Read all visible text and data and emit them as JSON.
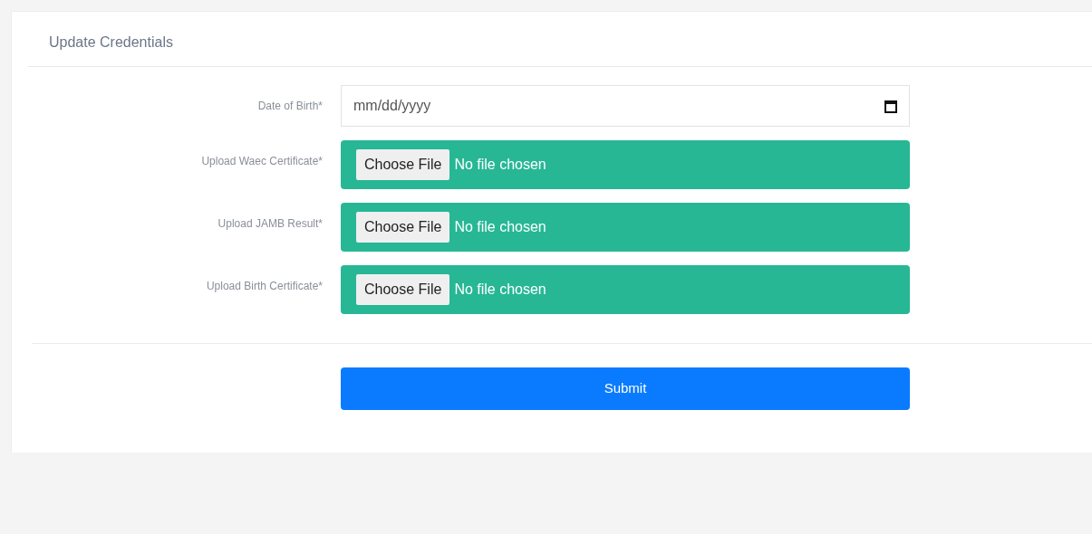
{
  "card": {
    "title": "Update Credentials"
  },
  "fields": [
    {
      "kind": "date",
      "label": "Date of Birth*",
      "placeholder": "mm/dd/yyyy"
    },
    {
      "kind": "file",
      "label": "Upload Waec Certificate*",
      "button": "Choose File",
      "status": "No file chosen"
    },
    {
      "kind": "file",
      "label": "Upload JAMB Result*",
      "button": "Choose File",
      "status": "No file chosen"
    },
    {
      "kind": "file",
      "label": "Upload Birth Certificate*",
      "button": "Choose File",
      "status": "No file chosen"
    }
  ],
  "submit": {
    "label": "Submit"
  }
}
